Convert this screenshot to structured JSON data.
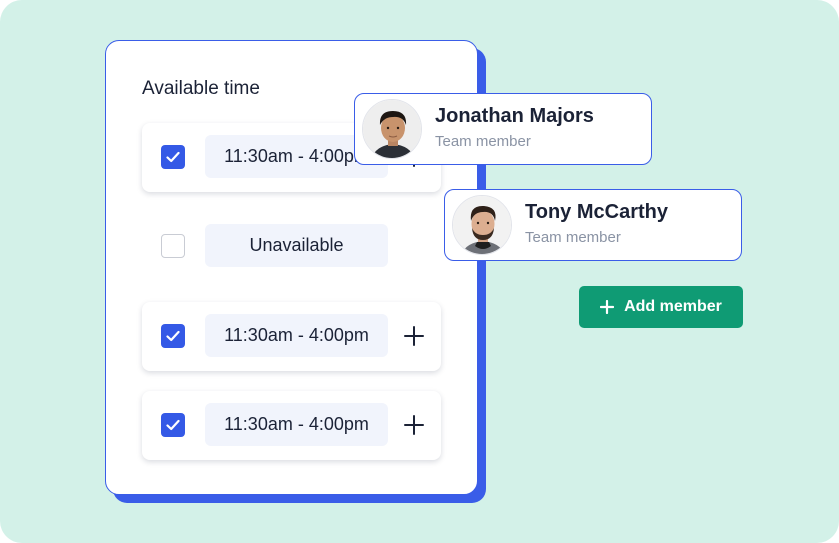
{
  "colors": {
    "background": "#d3f1e8",
    "accent_blue": "#3459e6",
    "button_green": "#0f9b74",
    "text_dark": "#1b2236",
    "text_muted": "#8a93a4"
  },
  "availability": {
    "title": "Available time",
    "rows": [
      {
        "checked": true,
        "label": "11:30am - 4:00pm",
        "has_add": true
      },
      {
        "checked": false,
        "label": "Unavailable",
        "has_add": false
      },
      {
        "checked": true,
        "label": "11:30am - 4:00pm",
        "has_add": true
      },
      {
        "checked": true,
        "label": "11:30am - 4:00pm",
        "has_add": true
      }
    ]
  },
  "members": [
    {
      "name": "Jonathan Majors",
      "role": "Team member"
    },
    {
      "name": "Tony McCarthy",
      "role": "Team member"
    }
  ],
  "add_member": {
    "label": "Add member",
    "icon": "plus-icon"
  }
}
